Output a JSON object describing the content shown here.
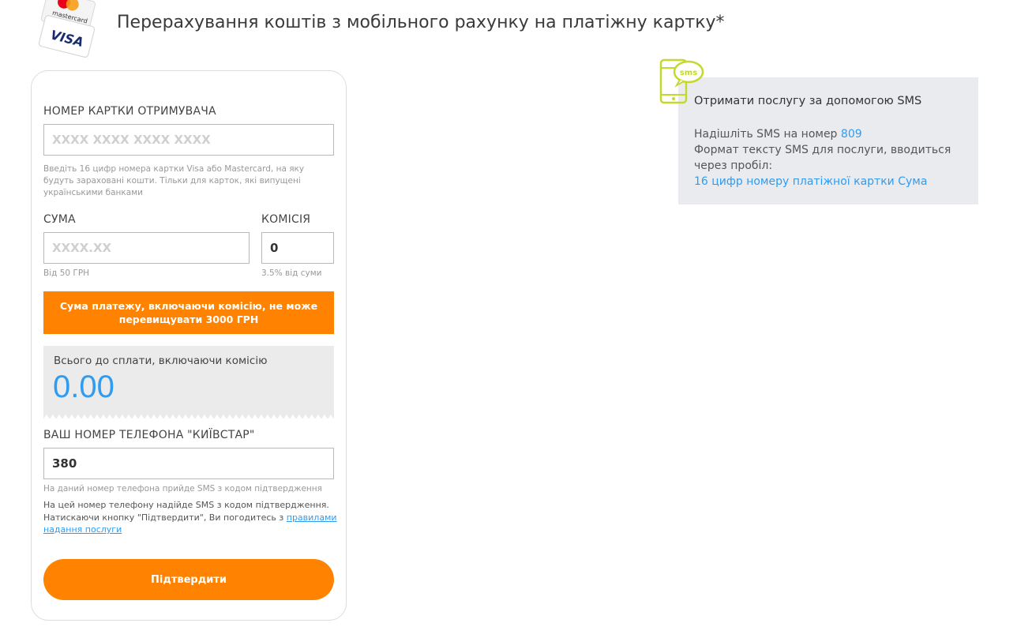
{
  "header": {
    "title": "Перерахування коштів з мобільного рахунку на платіжну картку*",
    "logo_text_mastercard": "mastercard",
    "logo_text_visa": "VISA"
  },
  "form": {
    "card_label": "НОМЕР КАРТКИ ОТРИМУВАЧА",
    "card_placeholder": "XXXX XXXX XXXX XXXX",
    "card_hint": "Введіть 16 цифр номера картки Visa або Mastercard, на яку будуть зараховані кошти. Тільки для карток, які випущені українськими банками",
    "amount_label": "СУМА",
    "amount_placeholder": "XXXX.XX",
    "amount_hint": "Від 50 ГРН",
    "fee_label": "КОМІСІЯ",
    "fee_value": "0",
    "fee_hint": "3.5% від суми",
    "warning": "Сума платежу, включаючи комісію, не може перевищувати 3000 ГРН",
    "total_label": "Всього до сплати, включаючи комісію",
    "total_value": "0.00",
    "phone_label": "ВАШ НОМЕР ТЕЛЕФОНА \"КИЇВСТАР\"",
    "phone_value": "380",
    "phone_hint": "На даний номер телефона прийде SMS з кодом підтвердження",
    "note_text": "На цей номер телефону надійде SMS з кодом підтвердження. Натискаючи кнопку \"Підтвердити\", Ви погодитесь з ",
    "note_link": "правилами надання послуги",
    "confirm_label": "Підтвердити"
  },
  "sms": {
    "icon_text": "sms",
    "title": "Отримати послугу за допомогою SMS",
    "line1_prefix": "Надішліть SMS на номер ",
    "number": "809",
    "line2": "Формат тексту SMS для послуги, вводиться через пробіл:",
    "format": "16 цифр номеру платіжної картки Сума"
  },
  "colors": {
    "accent_orange": "#ff8200",
    "link_blue": "#2e9cf2",
    "sms_icon_green": "#c5d82e"
  }
}
